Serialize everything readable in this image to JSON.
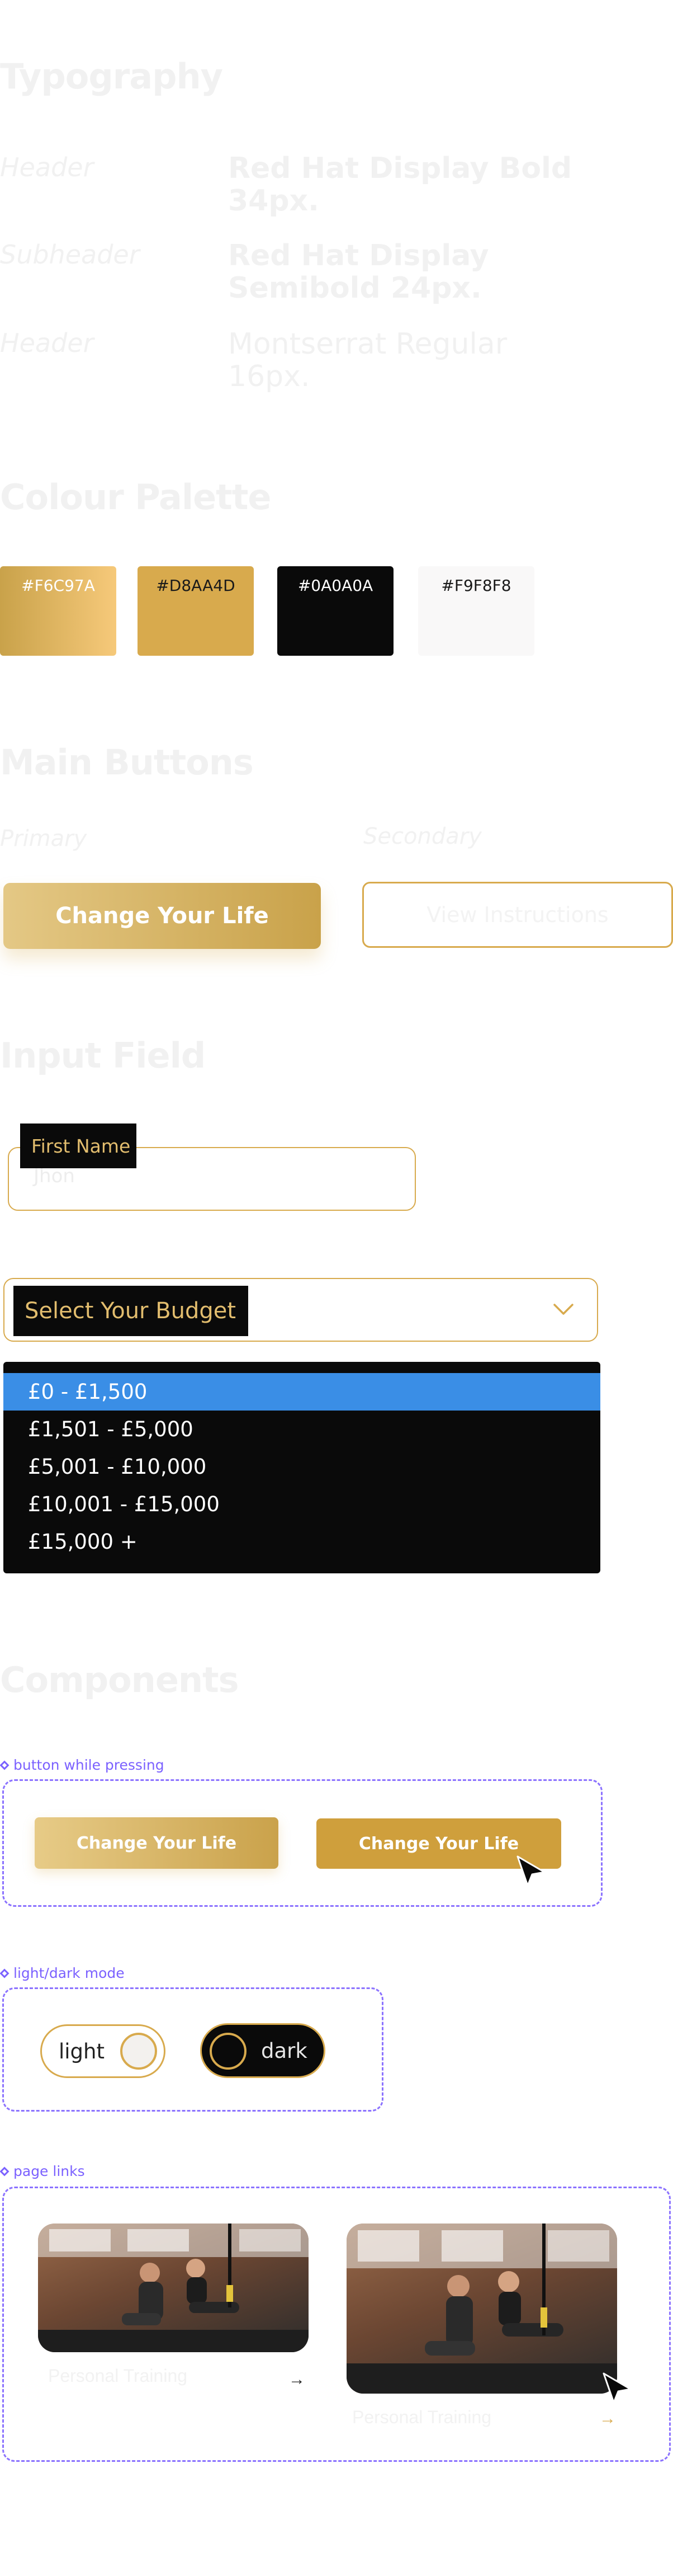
{
  "typography": {
    "title": "Typography",
    "rows": [
      {
        "label": "Header",
        "value": "Red Hat Display Bold 34px."
      },
      {
        "label": "Subheader",
        "value": "Red Hat Display Semibold 24px."
      },
      {
        "label": "Header",
        "value": "Montserrat Regular 16px."
      }
    ]
  },
  "palette": {
    "title": "Colour Palette",
    "swatches": [
      {
        "hex": "#F6C97A",
        "color": "#F6C97A"
      },
      {
        "hex": "#D8AA4D",
        "color": "#D8AA4D"
      },
      {
        "hex": "#0A0A0A",
        "color": "#0A0A0A"
      },
      {
        "hex": "#F9F8F8",
        "color": "#F9F8F8"
      }
    ]
  },
  "buttons": {
    "title": "Main Buttons",
    "primary_label": "Primary",
    "secondary_label": "Secondary",
    "primary_button": "Change Your Life",
    "secondary_button": "View Instructions"
  },
  "input": {
    "title": "Input Field",
    "first_name_label": "First Name",
    "first_name_value": "Jhon",
    "budget_label": "Select Your Budget",
    "budget_options": [
      "£0 - £1,500",
      "£1,501 - £5,000",
      "£5,001 - £10,000",
      "£10,001 - £15,000",
      "£15,000 +"
    ],
    "selected_option": "£0 - £1,500"
  },
  "components": {
    "title": "Components",
    "pressing_label": "button while pressing",
    "pressing_button_normal": "Change Your Life",
    "pressing_button_pressed": "Change Your Life",
    "mode_label": "light/dark mode",
    "light_label": "light",
    "dark_label": "dark",
    "links_label": "page links",
    "link_captions": [
      "Personal Training",
      "Personal Training"
    ],
    "link_arrow": "→"
  },
  "colors": {
    "gold": "#D8AA4D",
    "light_gold": "#F6C97A",
    "black": "#0A0A0A",
    "off_white": "#F9F8F8",
    "selected_blue": "#3A8EE6",
    "annotation_purple": "#7B61FF"
  },
  "icons": [
    "chevron-down-icon",
    "cursor-arrow-icon",
    "arrow-right-icon",
    "diamond-icon"
  ]
}
